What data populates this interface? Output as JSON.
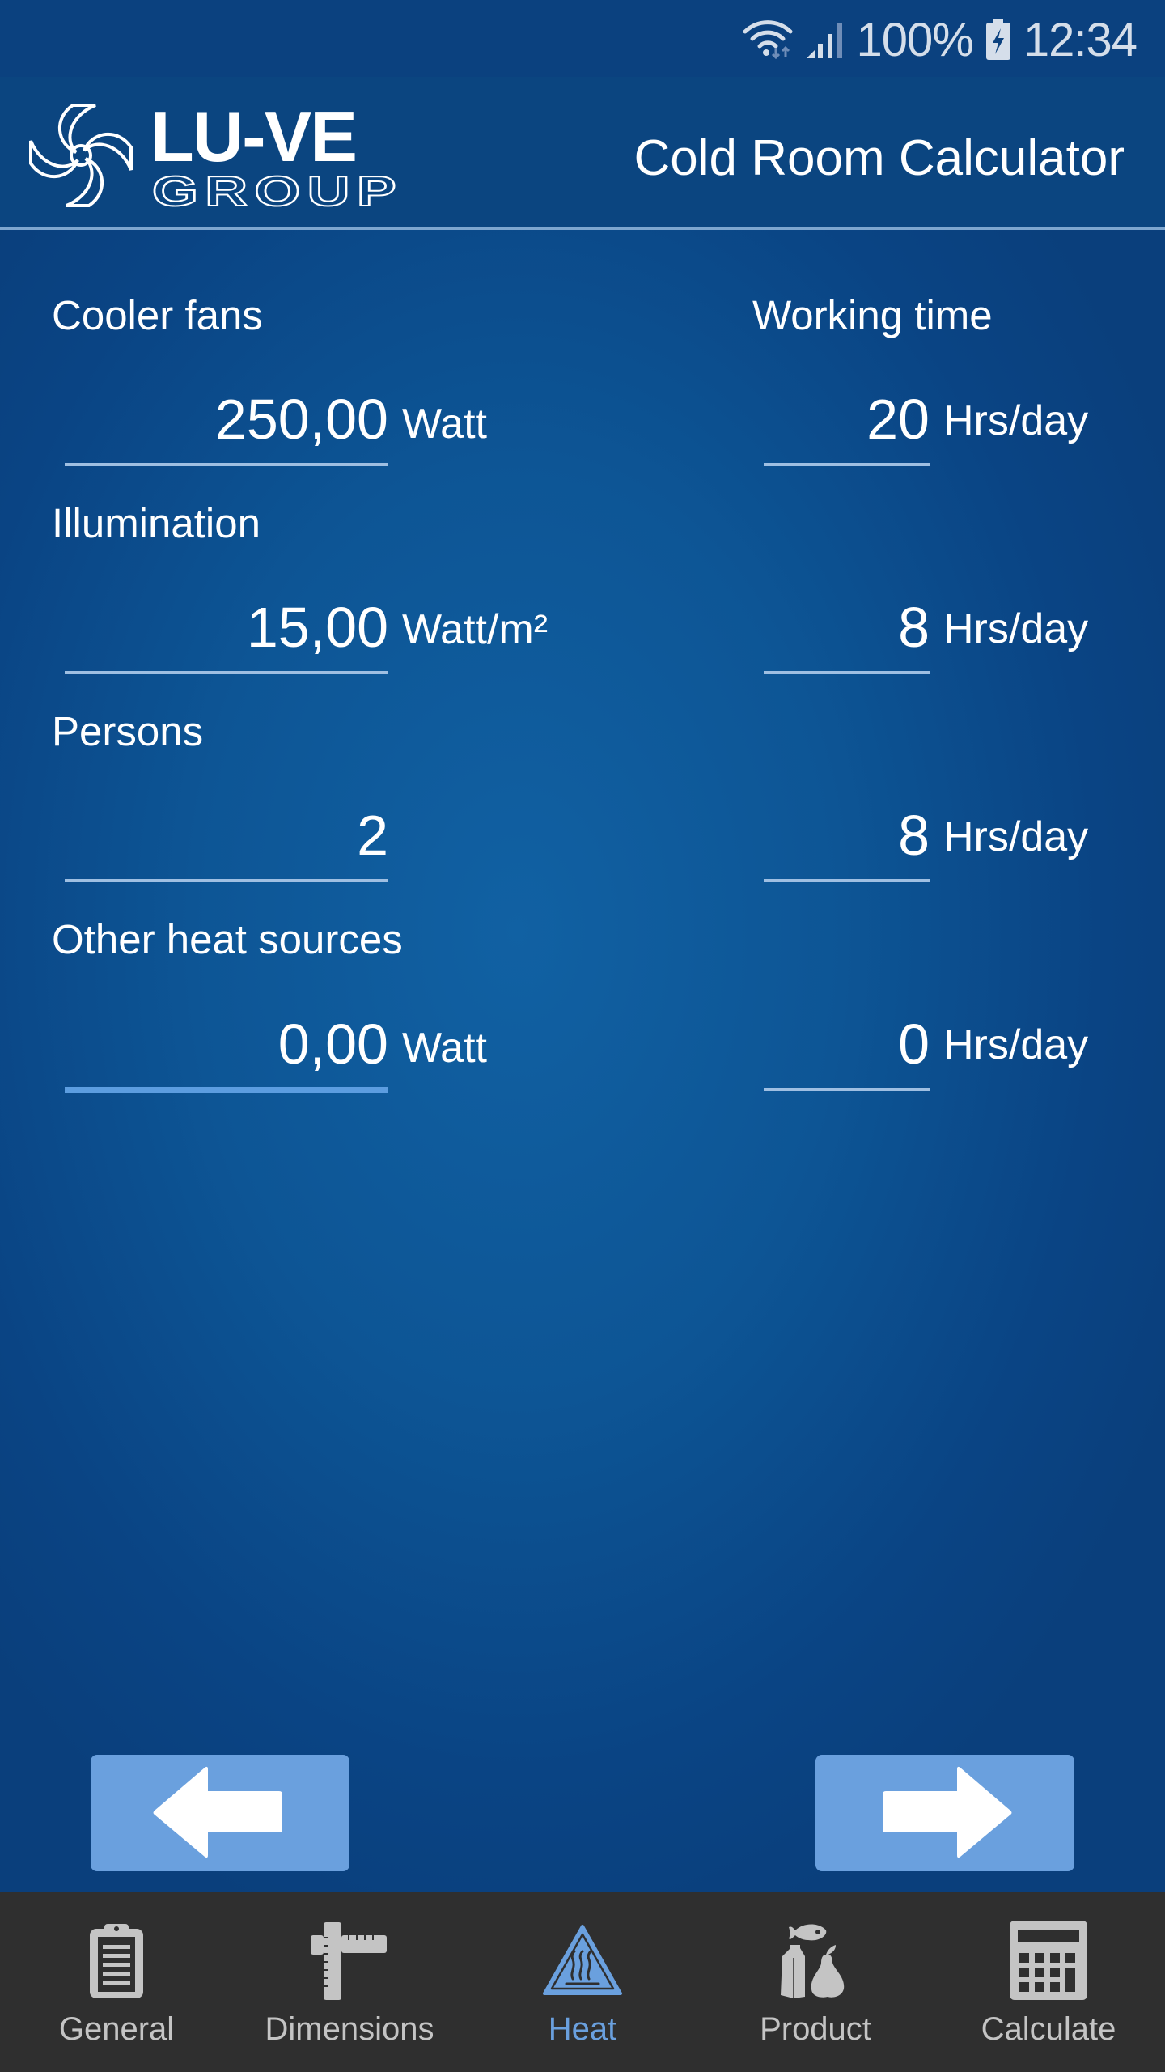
{
  "status_bar": {
    "battery_percent": "100%",
    "time": "12:34",
    "icons": [
      "wifi-icon",
      "signal-icon",
      "battery-charging-icon"
    ]
  },
  "header": {
    "logo_text": "LU-VE",
    "logo_subtext": "GROUP",
    "title": "Cold Room Calculator"
  },
  "form": {
    "working_time_label": "Working time",
    "rows": [
      {
        "label": "Cooler fans",
        "value": "250,00",
        "unit": "Watt",
        "hours": "20",
        "hours_unit": "Hrs/day"
      },
      {
        "label": "Illumination",
        "value": "15,00",
        "unit": "Watt/m²",
        "hours": "8",
        "hours_unit": "Hrs/day"
      },
      {
        "label": "Persons",
        "value": "2",
        "unit": "",
        "hours": "8",
        "hours_unit": "Hrs/day"
      },
      {
        "label": "Other heat sources",
        "value": "0,00",
        "unit": "Watt",
        "hours": "0",
        "hours_unit": "Hrs/day"
      }
    ]
  },
  "navigation": {
    "back_icon": "arrow-left-icon",
    "next_icon": "arrow-right-icon"
  },
  "tabs": [
    {
      "label": "General",
      "icon": "clipboard-icon",
      "active": false
    },
    {
      "label": "Dimensions",
      "icon": "ruler-icon",
      "active": false
    },
    {
      "label": "Heat",
      "icon": "heat-warning-icon",
      "active": true
    },
    {
      "label": "Product",
      "icon": "food-products-icon",
      "active": false
    },
    {
      "label": "Calculate",
      "icon": "calculator-icon",
      "active": false
    }
  ],
  "colors": {
    "background": "#0d5595",
    "header": "#0b4580",
    "accent": "#6aa0de",
    "tabbar": "#2f2f2f",
    "tab_inactive": "#c4c4c4"
  }
}
